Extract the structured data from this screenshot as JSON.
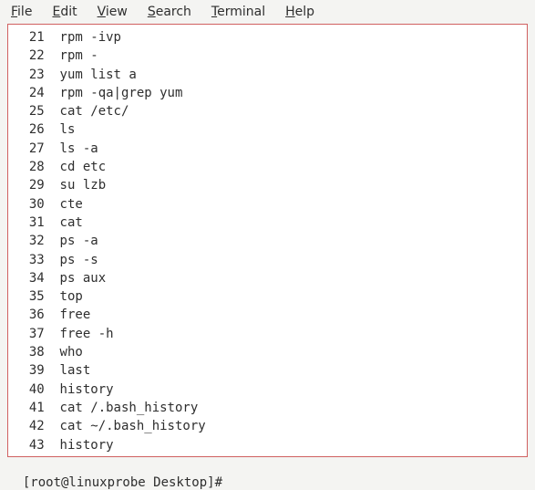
{
  "menubar": {
    "items": [
      {
        "label": "File",
        "accel_index": 0
      },
      {
        "label": "Edit",
        "accel_index": 0
      },
      {
        "label": "View",
        "accel_index": 0
      },
      {
        "label": "Search",
        "accel_index": 0
      },
      {
        "label": "Terminal",
        "accel_index": 0
      },
      {
        "label": "Help",
        "accel_index": 0
      }
    ]
  },
  "history": [
    {
      "n": "21",
      "cmd": "rpm -ivp"
    },
    {
      "n": "22",
      "cmd": "rpm -"
    },
    {
      "n": "23",
      "cmd": "yum list a"
    },
    {
      "n": "24",
      "cmd": "rpm -qa|grep yum"
    },
    {
      "n": "25",
      "cmd": "cat /etc/"
    },
    {
      "n": "26",
      "cmd": "ls"
    },
    {
      "n": "27",
      "cmd": "ls -a"
    },
    {
      "n": "28",
      "cmd": "cd etc"
    },
    {
      "n": "29",
      "cmd": "su lzb"
    },
    {
      "n": "30",
      "cmd": "cte"
    },
    {
      "n": "31",
      "cmd": "cat"
    },
    {
      "n": "32",
      "cmd": "ps -a"
    },
    {
      "n": "33",
      "cmd": "ps -s"
    },
    {
      "n": "34",
      "cmd": "ps aux"
    },
    {
      "n": "35",
      "cmd": "top"
    },
    {
      "n": "36",
      "cmd": "free"
    },
    {
      "n": "37",
      "cmd": "free -h"
    },
    {
      "n": "38",
      "cmd": "who"
    },
    {
      "n": "39",
      "cmd": "last"
    },
    {
      "n": "40",
      "cmd": "history"
    },
    {
      "n": "41",
      "cmd": "cat /.bash_history"
    },
    {
      "n": "42",
      "cmd": "cat ~/.bash_history"
    },
    {
      "n": "43",
      "cmd": "history"
    }
  ],
  "prompt": "[root@linuxprobe Desktop]# "
}
